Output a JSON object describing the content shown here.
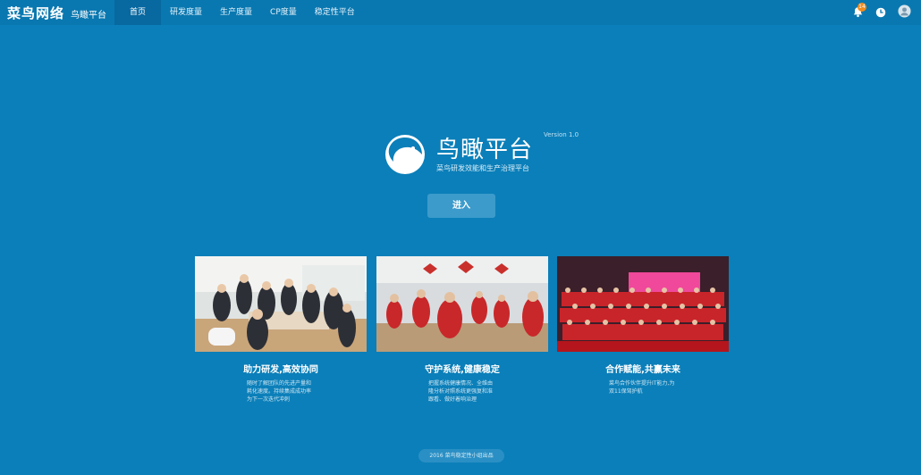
{
  "brand": {
    "name": "菜鸟网络",
    "product": "鸟瞰平台"
  },
  "nav": [
    {
      "label": "首页",
      "active": true
    },
    {
      "label": "研发度量",
      "active": false
    },
    {
      "label": "生产度量",
      "active": false
    },
    {
      "label": "CP度量",
      "active": false
    },
    {
      "label": "稳定性平台",
      "active": false
    }
  ],
  "top_icons": {
    "notifications": {
      "icon": "bell-icon",
      "count": "14"
    },
    "clock": {
      "icon": "clock-icon"
    },
    "user": {
      "icon": "user-avatar-icon"
    }
  },
  "hero": {
    "title": "鸟瞰平台",
    "version": "Version 1.0",
    "subtitle": "菜鸟研发效能和生产治理平台",
    "enter_label": "进入"
  },
  "cards": [
    {
      "title": "助力研发,高效协同",
      "desc": "随时了解团队的先进产量和耗化速度。持续集成成功率为下一次迭代冲刺"
    },
    {
      "title": "守护系统,健康稳定",
      "desc": "把握系统健康情况、全维由隆分析对照系统更强复和准跟看、做好着响治理"
    },
    {
      "title": "合作赋能,共赢未来",
      "desc": "菜鸟合作伙伴提升IT能力,为双11保驾护航"
    }
  ],
  "footer": {
    "text": "2016 菜鸟稳定性小组出品"
  },
  "colors": {
    "background": "#0b7fb9",
    "topbar": "#0a78b0",
    "active_tab": "#0868a0",
    "button": "#3c9bcb",
    "badge": "#f28c1c"
  }
}
